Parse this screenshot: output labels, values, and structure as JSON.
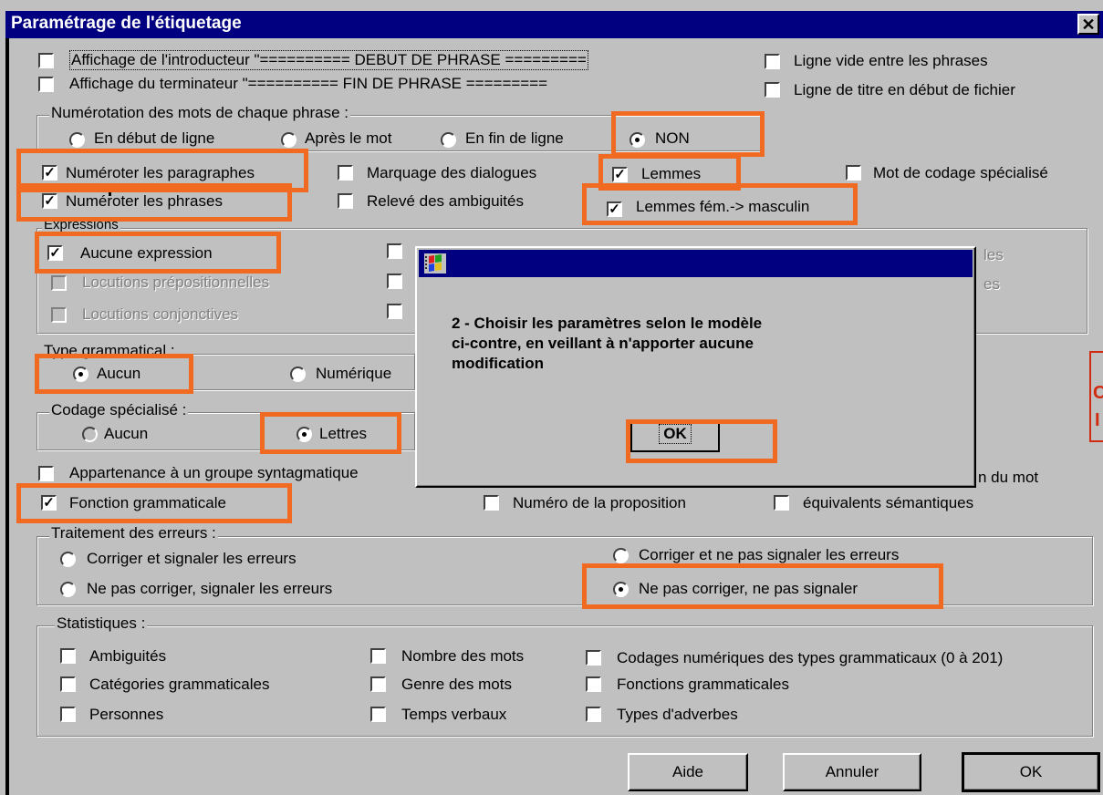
{
  "window": {
    "title": "Paramétrage de l'étiquetage",
    "close_glyph": "✕"
  },
  "options_top": {
    "intro": "Affichage de l'introducteur \"========== DEBUT DE PHRASE =========",
    "term": "Affichage du terminateur \"========== FIN DE PHRASE =========",
    "blank_line": "Ligne vide entre les phrases",
    "title_line": "Ligne de titre en début de fichier"
  },
  "numbering": {
    "label": "Numérotation des mots de chaque phrase :",
    "options": [
      "En début de ligne",
      "Après le mot",
      "En fin de ligne",
      "NON"
    ],
    "selected": "NON"
  },
  "flags": {
    "para": "Numéroter les paragraphes",
    "phr": "Numéroter les phrases",
    "dialog": "Marquage des dialogues",
    "ambig": "Relevé des ambiguités",
    "lemmes": "Lemmes",
    "lemmes_fem": "Lemmes fém.-> masculin",
    "special": "Mot de codage spécialisé"
  },
  "expressions": {
    "label": "Expressions",
    "none": "Aucune expression",
    "prep": "Locutions prépositionnelles",
    "conj": "Locutions conjonctives",
    "right_1": "les",
    "right_2": "es"
  },
  "type_gram": {
    "label": "Type grammatical :",
    "none": "Aucun",
    "num": "Numérique"
  },
  "codage": {
    "label": "Codage spécialisé :",
    "none": "Aucun",
    "letters": "Lettres"
  },
  "synt": {
    "group": "Appartenance à un groupe syntagmatique",
    "fonction": "Fonction grammaticale",
    "prop": "Numéro de la proposition",
    "sem": "équivalents sémantiques",
    "right": "n du mot"
  },
  "errors": {
    "label": "Traitement des erreurs :",
    "o1": "Corriger et signaler les erreurs",
    "o2": "Corriger et ne pas signaler les erreurs",
    "o3": "Ne pas corriger, signaler les erreurs",
    "o4": "Ne pas corriger, ne pas signaler"
  },
  "stats": {
    "label": "Statistiques :",
    "ambig": "Ambiguités",
    "cat": "Catégories grammaticales",
    "pers": "Personnes",
    "nb": "Nombre des mots",
    "genre": "Genre des mots",
    "temps": "Temps verbaux",
    "codes": "Codages numériques des types grammaticaux (0 à 201)",
    "fonc": "Fonctions grammaticales",
    "adv": "Types d'adverbes"
  },
  "buttons": {
    "help": "Aide",
    "cancel": "Annuler",
    "ok": "OK"
  },
  "popup": {
    "line1": "2 - Choisir les paramètres selon le modèle",
    "line2": "ci-contre, en veillant à n'apporter aucune",
    "line3": "modification",
    "ok": "OK"
  },
  "fragment": {
    "top": "C",
    "bottom": "I"
  },
  "colors": {
    "highlight": "#f06a22",
    "titlebar": "#000080",
    "face": "#c0c0c0"
  }
}
